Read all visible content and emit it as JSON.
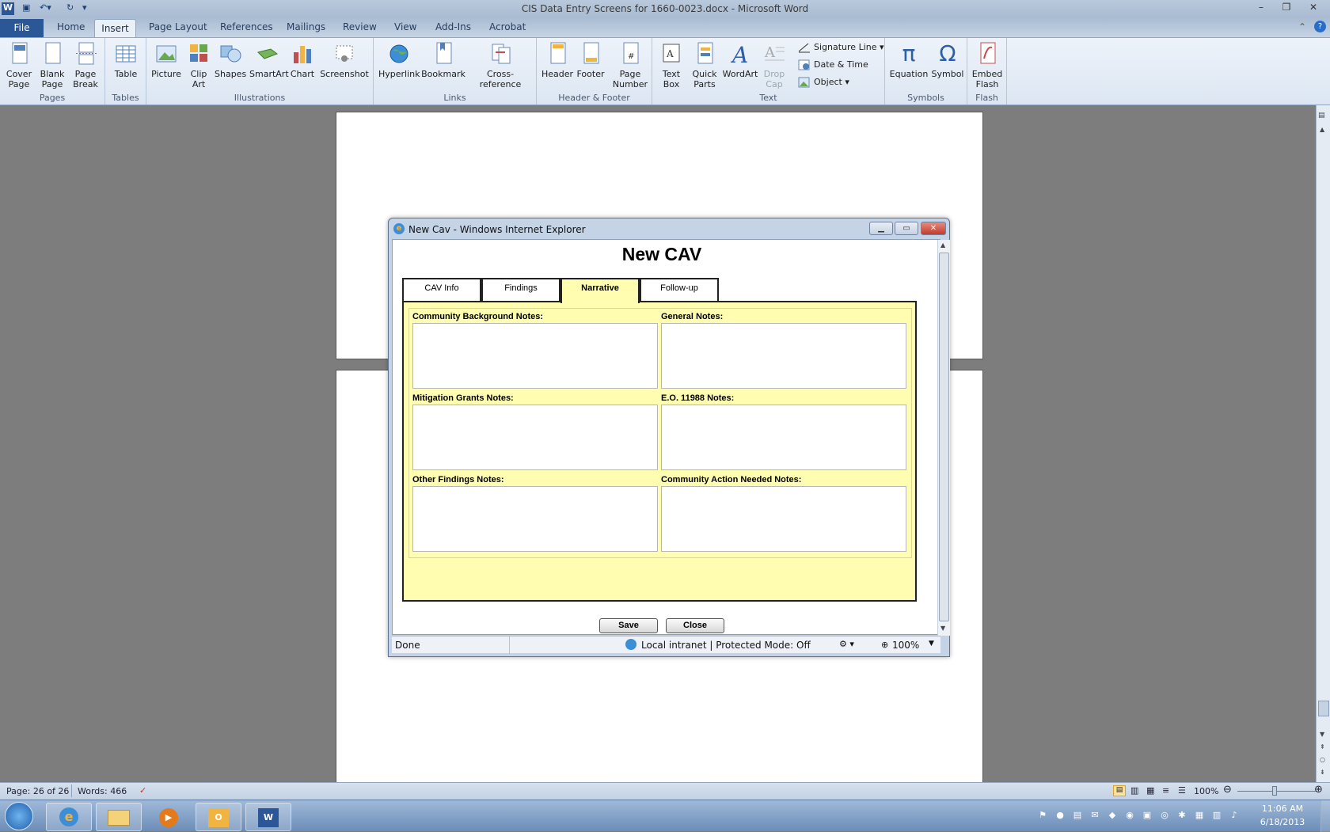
{
  "window": {
    "title": "CIS Data Entry Screens for 1660-0023.docx - Microsoft Word"
  },
  "ribbon": {
    "tabs": [
      "File",
      "Home",
      "Insert",
      "Page Layout",
      "References",
      "Mailings",
      "Review",
      "View",
      "Add-Ins",
      "Acrobat"
    ],
    "active_tab": "Insert",
    "groups": {
      "pages": {
        "label": "Pages",
        "items": [
          "Cover Page",
          "Blank Page",
          "Page Break"
        ]
      },
      "tables": {
        "label": "Tables",
        "items": [
          "Table"
        ]
      },
      "illustrations": {
        "label": "Illustrations",
        "items": [
          "Picture",
          "Clip Art",
          "Shapes",
          "SmartArt",
          "Chart",
          "Screenshot"
        ]
      },
      "links": {
        "label": "Links",
        "items": [
          "Hyperlink",
          "Bookmark",
          "Cross-reference"
        ]
      },
      "header_footer": {
        "label": "Header & Footer",
        "items": [
          "Header",
          "Footer",
          "Page Number"
        ]
      },
      "text": {
        "label": "Text",
        "items": [
          "Text Box",
          "Quick Parts",
          "WordArt",
          "Drop Cap"
        ],
        "small": [
          "Signature Line",
          "Date & Time",
          "Object"
        ]
      },
      "symbols": {
        "label": "Symbols",
        "items": [
          "Equation",
          "Symbol"
        ]
      },
      "flash": {
        "label": "Flash",
        "items": [
          "Embed Flash"
        ]
      }
    }
  },
  "ie": {
    "title": "New Cav - Windows Internet Explorer",
    "page_title": "New CAV",
    "tabs": [
      "CAV Info",
      "Findings",
      "Narrative",
      "Follow-up"
    ],
    "active_tab": "Narrative",
    "fields": [
      "Community Background Notes:",
      "General Notes:",
      "Mitigation Grants Notes:",
      "E.O. 11988 Notes:",
      "Other Findings Notes:",
      "Community Action Needed Notes:"
    ],
    "buttons": {
      "save": "Save",
      "close": "Close"
    },
    "status": {
      "left": "Done",
      "zone": "Local intranet | Protected Mode: Off",
      "zoom": "100%"
    }
  },
  "statusbar": {
    "page": "Page: 26 of 26",
    "words": "Words: 466",
    "zoom": "100%"
  },
  "taskbar": {
    "time": "11:06 AM",
    "date": "6/18/2013"
  },
  "colors": {
    "accent": "#2b5797",
    "form_bg": "#fffdb0"
  }
}
